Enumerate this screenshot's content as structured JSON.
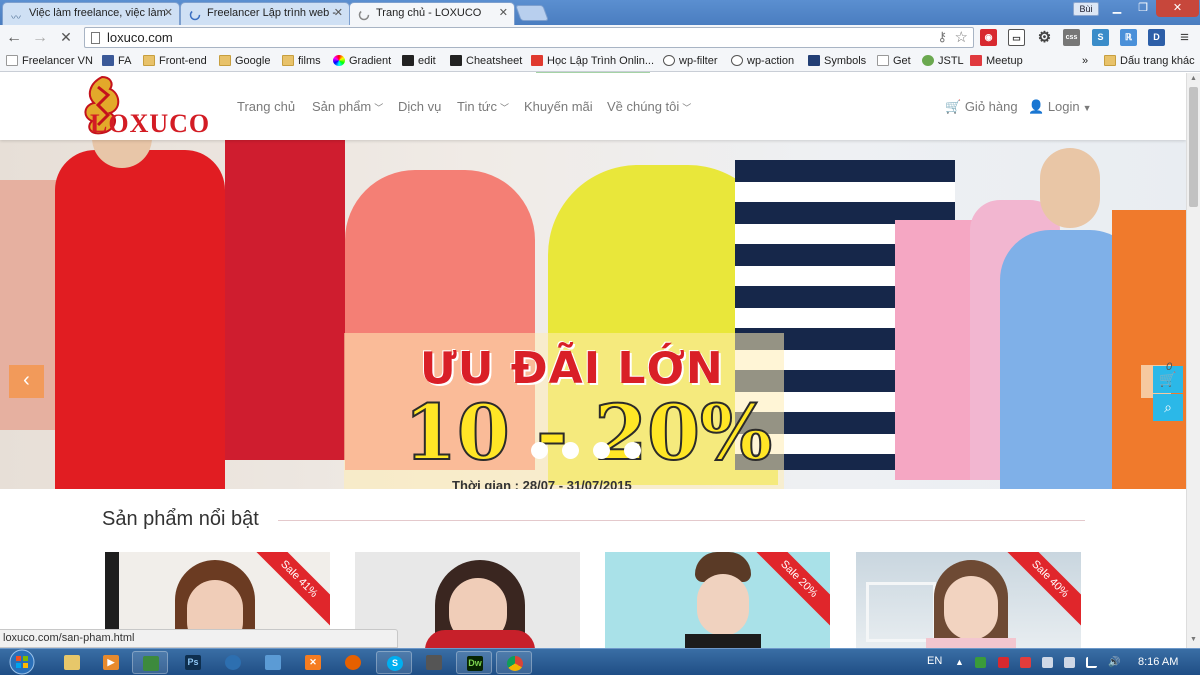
{
  "browser": {
    "tabs": [
      {
        "title": "Việc làm freelance, việc làm"
      },
      {
        "title": "Freelancer Lập trình web -"
      },
      {
        "title": "Trang chủ - LOXUCO"
      }
    ],
    "user_button": "Bùi",
    "url": "loxuco.com",
    "bookmarks": [
      {
        "label": "Freelancer VN"
      },
      {
        "label": "FA"
      },
      {
        "label": "Front-end"
      },
      {
        "label": "Google"
      },
      {
        "label": "films"
      },
      {
        "label": "Gradient"
      },
      {
        "label": "edit"
      },
      {
        "label": "Cheatsheet"
      },
      {
        "label": "Học Lập Trình Onlin..."
      },
      {
        "label": "wp-filter"
      },
      {
        "label": "wp-action"
      },
      {
        "label": "Symbols"
      },
      {
        "label": "Get"
      },
      {
        "label": "JSTL"
      },
      {
        "label": "Meetup"
      }
    ],
    "bookmarks_overflow": "»",
    "other_bookmarks": "Dấu trang khác",
    "status_url": "loxuco.com/san-pham.html"
  },
  "site": {
    "logo_text": "LOXUCO",
    "nav": [
      {
        "label": "Trang chủ"
      },
      {
        "label": "Sản phẩm"
      },
      {
        "label": "Dịch vụ"
      },
      {
        "label": "Tin tức"
      },
      {
        "label": "Khuyến mãi"
      },
      {
        "label": "Về chúng tôi"
      }
    ],
    "cart_label": "Giỏ hàng",
    "login_label": "Login",
    "hero": {
      "promo_title": "ƯU ĐÃI LỚN",
      "promo_percent": "10 - 20%",
      "promo_date": "Thời gian : 28/07 - 31/07/2015",
      "slide_count": 4
    },
    "cart_count": "0",
    "featured_title": "Sản phẩm nổi bật",
    "products": [
      {
        "badge": "Sale 41%"
      },
      {
        "badge": ""
      },
      {
        "badge": "Sale 20%"
      },
      {
        "badge": "Sale 40%"
      }
    ]
  },
  "taskbar": {
    "language": "EN",
    "clock": "8:16 AM"
  },
  "colors": {
    "brand_red": "#d31c24",
    "accent_orange": "#f29a5a",
    "accent_cyan": "#2bb8e8"
  }
}
